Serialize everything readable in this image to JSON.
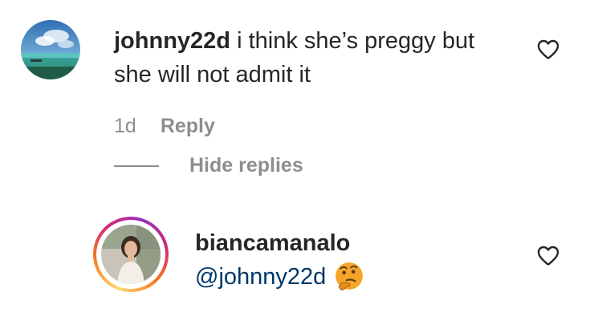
{
  "comment": {
    "username": "johnny22d",
    "text": " i think she’s preggy but she will not admit it",
    "age": "1d",
    "reply_label": "Reply",
    "hide_replies_label": "Hide replies",
    "liked": false
  },
  "reply": {
    "username": "biancamanalo",
    "mention": "@johnny22d",
    "emoji": "thinking-face",
    "liked": false,
    "has_story": true
  },
  "colors": {
    "text": "#262626",
    "muted": "#8e8e8e",
    "mention": "#00376b",
    "story_ring": [
      "#feda75",
      "#fa7e1e",
      "#d62976",
      "#962fbf"
    ]
  },
  "icons": [
    "heart-outline-icon",
    "thinking-face-emoji"
  ]
}
